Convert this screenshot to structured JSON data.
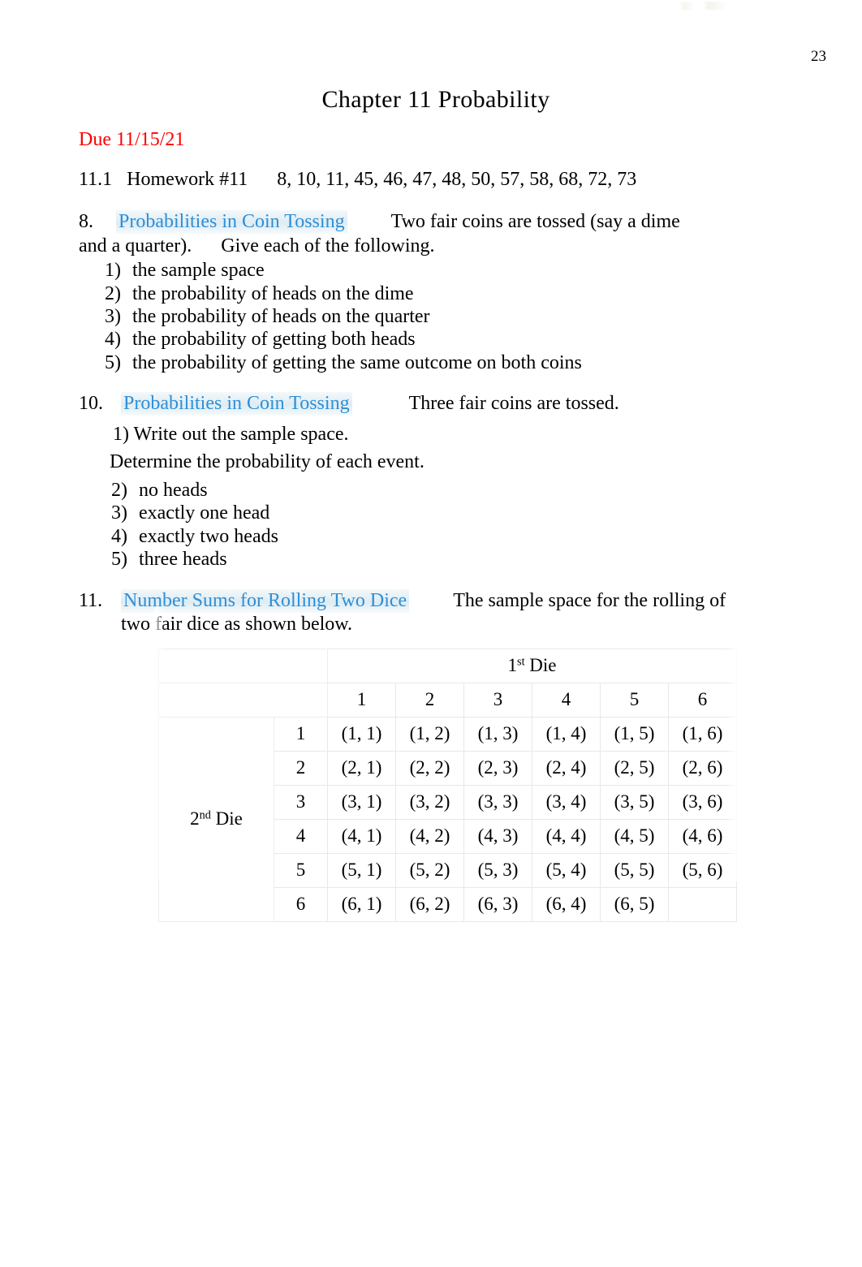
{
  "page": {
    "number": "23",
    "title": "Chapter  11  Probability",
    "due": "Due 11/15/21",
    "homework_line": "11.1   Homework #11      8, 10, 11, 45, 46, 47, 48, 50, 57, 58, 68, 72, 73"
  },
  "problems": [
    {
      "number": "8.",
      "title": "Probabilities in Coin Tossing",
      "intro_a": "Two fair coins are tossed (say a dime",
      "intro_b": "and a quarter).",
      "intro_c": "Give each of the following.",
      "items": [
        {
          "marker": "1)",
          "text": "the sample space"
        },
        {
          "marker": "2)",
          "text": "the probability of heads on the dime"
        },
        {
          "marker": "3)",
          "text": "the probability of heads on the quarter"
        },
        {
          "marker": "4)",
          "text": "the probability of getting both heads"
        },
        {
          "marker": "5)",
          "text": "the probability of getting the same outcome on both coins"
        }
      ]
    },
    {
      "number": "10.",
      "title": "Probabilities in Coin Tossing",
      "intro_a": "Three fair coins are tossed.",
      "line_1": "1) Write out the sample space.",
      "line_2": "Determine the probability of each event.",
      "items": [
        {
          "marker": "2)",
          "text": "no heads"
        },
        {
          "marker": "3)",
          "text": "exactly one head"
        },
        {
          "marker": "4)",
          "text": "exactly two heads"
        },
        {
          "marker": "5)",
          "text": "three heads"
        }
      ]
    },
    {
      "number": "11.",
      "title": "Number Sums for Rolling Two Dice",
      "intro_a": "The sample space for the rolling of",
      "intro_b": "two fair dice as shown below."
    }
  ],
  "dice_table": {
    "col_group_label_prefix": "1",
    "col_group_label_sup": "st",
    "col_group_label_suffix": " Die",
    "row_group_label_prefix": "2",
    "row_group_label_sup": "nd",
    "row_group_label_suffix": " Die",
    "col_headers": [
      "1",
      "2",
      "3",
      "4",
      "5",
      "6"
    ],
    "row_headers": [
      "1",
      "2",
      "3",
      "4",
      "5",
      "6"
    ],
    "cells": [
      [
        "(1, 1)",
        "(1, 2)",
        "(1, 3)",
        "(1, 4)",
        "(1, 5)",
        "(1, 6)"
      ],
      [
        "(2, 1)",
        "(2, 2)",
        "(2, 3)",
        "(2, 4)",
        "(2, 5)",
        "(2, 6)"
      ],
      [
        "(3, 1)",
        "(3, 2)",
        "(3, 3)",
        "(3, 4)",
        "(3, 5)",
        "(3, 6)"
      ],
      [
        "(4, 1)",
        "(4, 2)",
        "(4, 3)",
        "(4, 4)",
        "(4, 5)",
        "(4, 6)"
      ],
      [
        "(5, 1)",
        "(5, 2)",
        "(5, 3)",
        "(5, 4)",
        "(5, 5)",
        "(5, 6)"
      ],
      [
        "(6, 1)",
        "(6, 2)",
        "(6, 3)",
        "(6, 4)",
        "(6, 5)",
        ""
      ]
    ]
  },
  "colors": {
    "due_red": "#FF0000",
    "title_blue": "#2E8FD6",
    "table_border": "#E8E8E8",
    "text": "#000000"
  }
}
